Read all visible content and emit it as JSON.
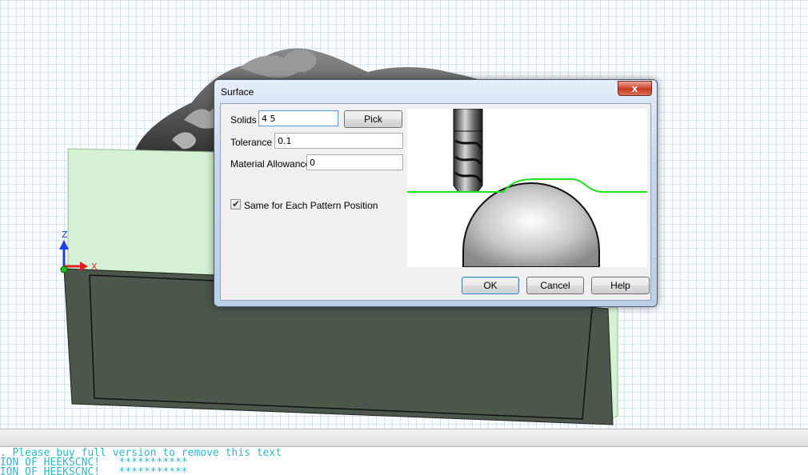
{
  "viewport": {
    "axis_z_label": "Z",
    "axis_x_label": "X",
    "colors": {
      "solid_face_top": "#d6f2d4",
      "solid_face_front": "#4b574b",
      "axis_red": "#e02020",
      "axis_blue": "#2040e0",
      "axis_green": "#20c020"
    }
  },
  "console": {
    "lines": [
      "C. Please buy full version to remove this text",
      "SION OF HEEKSCNC!   ***********",
      "SION OF HEEKSCNC!   ***********"
    ]
  },
  "dialog": {
    "title": "Surface",
    "close_glyph": "x",
    "solids_label": "Solids",
    "solids_value": "4 5",
    "pick_label": "Pick",
    "tolerance_label": "Tolerance",
    "tolerance_value": "0.1",
    "material_allowance_label": "Material Allowance",
    "material_allowance_value": "0",
    "same_for_each_label": "Same for Each Pattern Position",
    "same_for_each_checked": true,
    "ok_label": "OK",
    "cancel_label": "Cancel",
    "help_label": "Help"
  }
}
